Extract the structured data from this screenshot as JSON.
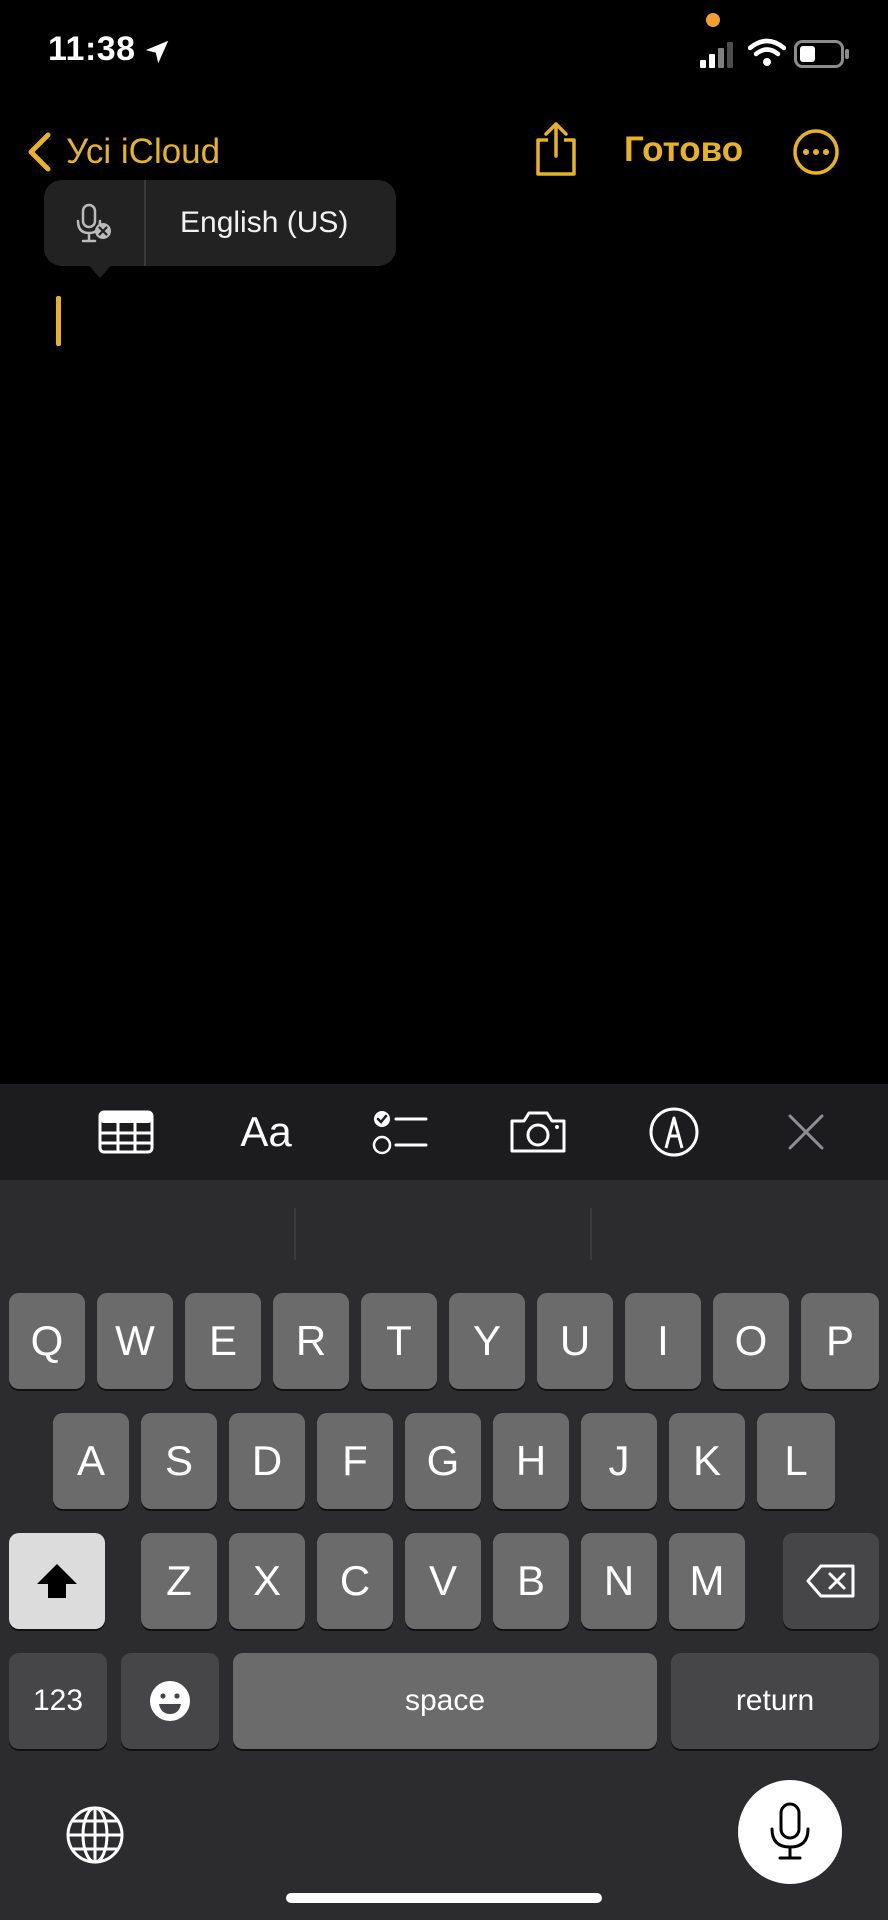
{
  "status_bar": {
    "time": "11:38"
  },
  "nav": {
    "back_label": "Усі iCloud",
    "done_label": "Готово"
  },
  "dictation_popover": {
    "language": "English (US)"
  },
  "keyboard": {
    "row1": [
      "Q",
      "W",
      "E",
      "R",
      "T",
      "Y",
      "U",
      "I",
      "O",
      "P"
    ],
    "row2": [
      "A",
      "S",
      "D",
      "F",
      "G",
      "H",
      "J",
      "K",
      "L"
    ],
    "row3": [
      "Z",
      "X",
      "C",
      "V",
      "B",
      "N",
      "M"
    ],
    "numbers_label": "123",
    "space_label": "space",
    "return_label": "return"
  },
  "colors": {
    "accent": "#e6b327",
    "background": "#000000",
    "keyboard_bg": "#2c2c2e",
    "key": "#6b6b6b"
  },
  "icons": [
    "location-arrow-icon",
    "signal-icon",
    "wifi-icon",
    "battery-icon",
    "chevron-left-icon",
    "share-icon",
    "more-icon",
    "mic-off-icon",
    "table-icon",
    "text-format-icon",
    "checklist-icon",
    "camera-icon",
    "markup-icon",
    "close-icon",
    "shift-icon",
    "delete-icon",
    "emoji-icon",
    "globe-icon",
    "mic-icon"
  ]
}
